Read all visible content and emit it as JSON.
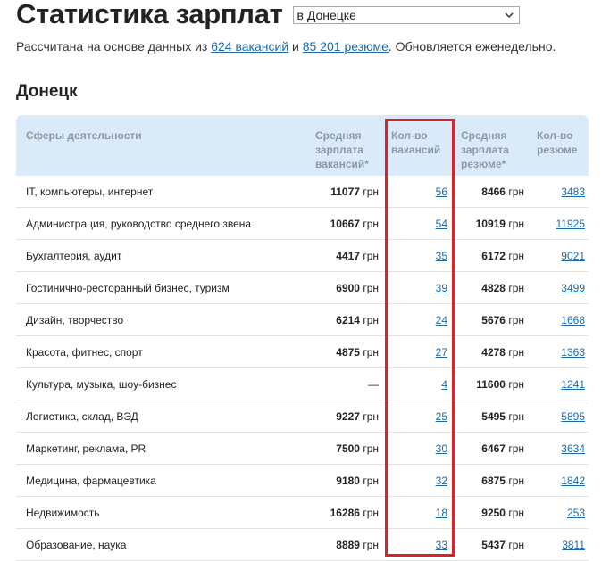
{
  "header": {
    "title": "Статистика зарплат",
    "city_select": "в Донецке",
    "subtitle_prefix": "Рассчитана на основе данных из ",
    "vacancies_link": "624 вакансий",
    "subtitle_and": " и ",
    "resumes_link": "85 201 резюме",
    "subtitle_suffix": ". Обновляется еженедельно."
  },
  "section": {
    "city": "Донецк"
  },
  "table": {
    "headers": {
      "sphere": "Сферы деятельности",
      "salary_vacancies": "Средняя зарплата вакансий*",
      "count_vacancies": "Кол-во вакансий",
      "salary_resumes": "Средняя зарплата резюме*",
      "count_resumes": "Кол-во резюме"
    },
    "unit": "грн",
    "rows": [
      {
        "sphere": "IT, компьютеры, интернет",
        "salary_vac": "11077",
        "count_vac": "56",
        "salary_res": "8466",
        "count_res": "3483"
      },
      {
        "sphere": "Администрация, руководство среднего звена",
        "salary_vac": "10667",
        "count_vac": "54",
        "salary_res": "10919",
        "count_res": "11925"
      },
      {
        "sphere": "Бухгалтерия, аудит",
        "salary_vac": "4417",
        "count_vac": "35",
        "salary_res": "6172",
        "count_res": "9021"
      },
      {
        "sphere": "Гостинично-ресторанный бизнес, туризм",
        "salary_vac": "6900",
        "count_vac": "39",
        "salary_res": "4828",
        "count_res": "3499"
      },
      {
        "sphere": "Дизайн, творчество",
        "salary_vac": "6214",
        "count_vac": "24",
        "salary_res": "5676",
        "count_res": "1668"
      },
      {
        "sphere": "Красота, фитнес, спорт",
        "salary_vac": "4875",
        "count_vac": "27",
        "salary_res": "4278",
        "count_res": "1363"
      },
      {
        "sphere": "Культура, музыка, шоу-бизнес",
        "salary_vac": "—",
        "count_vac": "4",
        "salary_res": "11600",
        "count_res": "1241"
      },
      {
        "sphere": "Логистика, склад, ВЭД",
        "salary_vac": "9227",
        "count_vac": "25",
        "salary_res": "5495",
        "count_res": "5895"
      },
      {
        "sphere": "Маркетинг, реклама, PR",
        "salary_vac": "7500",
        "count_vac": "30",
        "salary_res": "6467",
        "count_res": "3634"
      },
      {
        "sphere": "Медицина, фармацевтика",
        "salary_vac": "9180",
        "count_vac": "32",
        "salary_res": "6875",
        "count_res": "1842"
      },
      {
        "sphere": "Недвижимость",
        "salary_vac": "16286",
        "count_vac": "18",
        "salary_res": "9250",
        "count_res": "253"
      },
      {
        "sphere": "Образование, наука",
        "salary_vac": "8889",
        "count_vac": "33",
        "salary_res": "5437",
        "count_res": "3811"
      }
    ]
  },
  "colors": {
    "link": "#1c68a8",
    "header_bg": "#dbeaf8",
    "header_text": "#8b9aa8",
    "highlight": "#d8232a"
  }
}
